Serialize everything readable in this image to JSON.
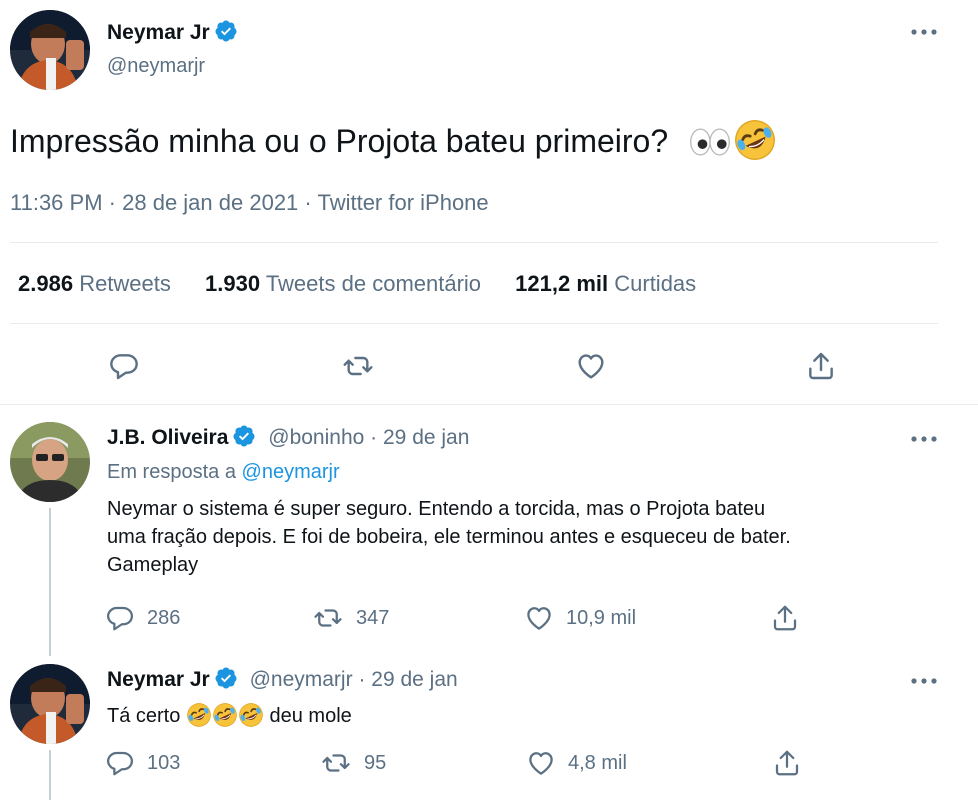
{
  "main_tweet": {
    "author_name": "Neymar Jr",
    "author_handle": "@neymarjr",
    "text": "Impressão minha ou o Projota bateu primeiro?",
    "time": "11:36 PM",
    "date": "28 de jan de 2021",
    "source": "Twitter for iPhone",
    "stats": {
      "retweets_count": "2.986",
      "retweets_label": "Retweets",
      "quote_count": "1.930",
      "quote_label": "Tweets de comentário",
      "likes_count": "121,2 mil",
      "likes_label": "Curtidas"
    }
  },
  "replies": [
    {
      "author_name": "J.B. Oliveira",
      "author_handle": "@boninho",
      "date": "29 de jan",
      "reply_prefix": "Em resposta a",
      "reply_to": "@neymarjr",
      "text_line1": "Neymar o sistema é super seguro. Entendo a torcida, mas o Projota bateu",
      "text_line2": "uma fração depois. E foi de bobeira, ele terminou antes e esqueceu de bater.",
      "text_line3": "Gameplay",
      "reply_count": "286",
      "retweet_count": "347",
      "like_count": "10,9 mil"
    },
    {
      "author_name": "Neymar Jr",
      "author_handle": "@neymarjr",
      "date": "29 de jan",
      "text_before": "Tá certo",
      "text_after": "deu mole",
      "reply_count": "103",
      "retweet_count": "95",
      "like_count": "4,8 mil"
    }
  ],
  "separator": "·",
  "colors": {
    "accent": "#1b95e0",
    "muted": "#5b7083",
    "text": "#0f1419",
    "divider": "#e6ecf0",
    "thread_line": "#c4cfd6"
  },
  "icons": [
    "verified-badge-icon",
    "more-options-icon",
    "reply-icon",
    "retweet-icon",
    "like-icon",
    "share-icon",
    "eyes-emoji",
    "rofl-emoji"
  ]
}
